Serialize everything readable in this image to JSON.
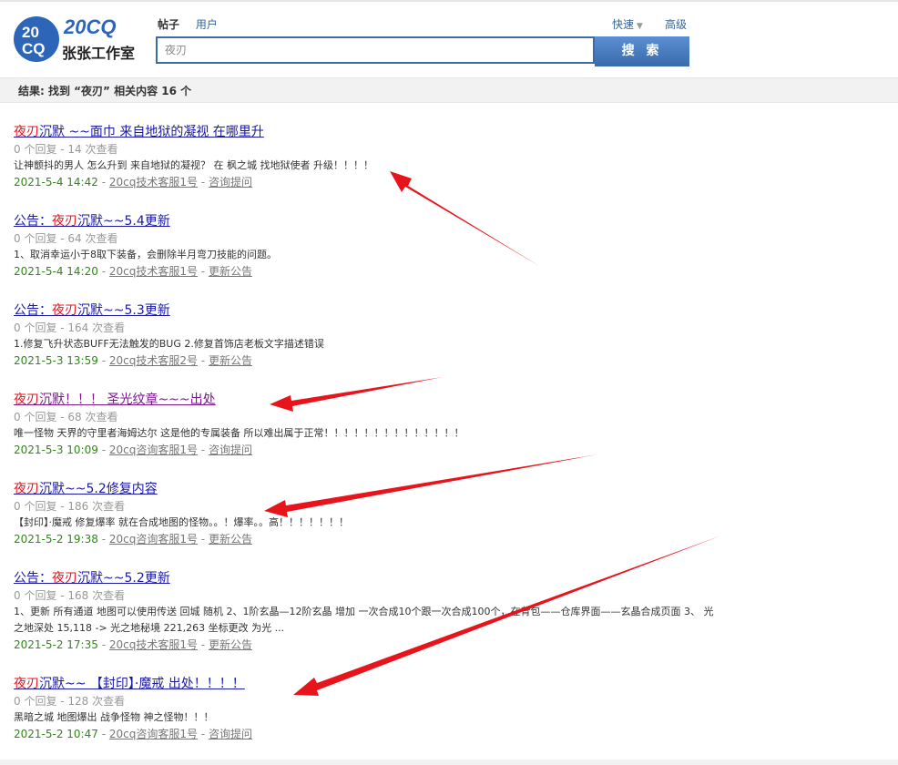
{
  "logo": {
    "mark": "20CQ",
    "name": "张张工作室"
  },
  "tabs": [
    "帖子",
    "用户"
  ],
  "quick_label": "快速",
  "advanced_label": "高级",
  "search": {
    "value": "夜刃",
    "button": "搜 索"
  },
  "result_summary": "结果: 找到 “夜刃” 相关内容 16 个",
  "results": [
    {
      "pre": "",
      "hl": "夜刃",
      "rest": "沉默 ~~面巾 来自地狱的凝视 在哪里升",
      "meta": "0 个回复 - 14 次查看",
      "desc": "让神颤抖的男人 怎么升到 来自地狱的凝视？ 在 枫之城 找地狱使者 升级！！！！",
      "date": "2021-5-4 14:42",
      "author": "20cq技术客服1号",
      "category": "咨询提问"
    },
    {
      "pre": "公告：",
      "hl": "夜刃",
      "rest": "沉默~~5.4更新",
      "meta": "0 个回复 - 64 次查看",
      "desc": "1、取消幸运小于8取下装备，会删除半月弯刀技能的问题。",
      "date": "2021-5-4 14:20",
      "author": "20cq技术客服1号",
      "category": "更新公告"
    },
    {
      "pre": "公告：",
      "hl": "夜刃",
      "rest": "沉默~~5.3更新",
      "meta": "0 个回复 - 164 次查看",
      "desc": "1.修复飞升状态BUFF无法触发的BUG 2.修复首饰店老板文字描述错误",
      "date": "2021-5-3 13:59",
      "author": "20cq技术客服2号",
      "category": "更新公告"
    },
    {
      "pre": "",
      "hl": "夜刃",
      "rest": "沉默！！！ 圣光纹章~~~出处",
      "meta": "0 个回复 - 68 次查看",
      "desc": "唯一怪物 天界的守里者海姆达尔 这是他的专属装备 所以难出属于正常！！！！！！！！！！！！！！",
      "date": "2021-5-3 10:09",
      "author": "20cq咨询客服1号",
      "category": "咨询提问"
    },
    {
      "pre": "",
      "hl": "夜刃",
      "rest": "沉默~~5.2修复内容",
      "meta": "0 个回复 - 186 次查看",
      "desc": "【封印】·魔戒 修复爆率 就在合成地图的怪物。。！爆率。。高！！！！！！！",
      "date": "2021-5-2 19:38",
      "author": "20cq咨询客服1号",
      "category": "更新公告"
    },
    {
      "pre": "公告：",
      "hl": "夜刃",
      "rest": "沉默~~5.2更新",
      "meta": "0 个回复 - 168 次查看",
      "desc": "1、更新 所有通道 地图可以使用传送 回城 随机 2、1阶玄晶—12阶玄晶 增加 一次合成10个跟一次合成100个，在背包——仓库界面——玄晶合成页面 3、 光之地深处 15,118 -> 光之地秘境 221,263 坐标更改 为光 ...",
      "date": "2021-5-2 17:35",
      "author": "20cq技术客服1号",
      "category": "更新公告"
    },
    {
      "pre": "",
      "hl": "夜刃",
      "rest": "沉默~~ 【封印】·魔戒 出处！！！！",
      "meta": "0 个回复 - 128 次查看",
      "desc": "黑暗之城 地图爆出 战争怪物 神之怪物！！！",
      "date": "2021-5-2 10:47",
      "author": "20cq咨询客服1号",
      "category": "咨询提问"
    }
  ],
  "colors": {
    "accent": "#3a6bab",
    "highlight": "#e1161f",
    "date": "#33851c",
    "arrow": "#e8141b"
  }
}
